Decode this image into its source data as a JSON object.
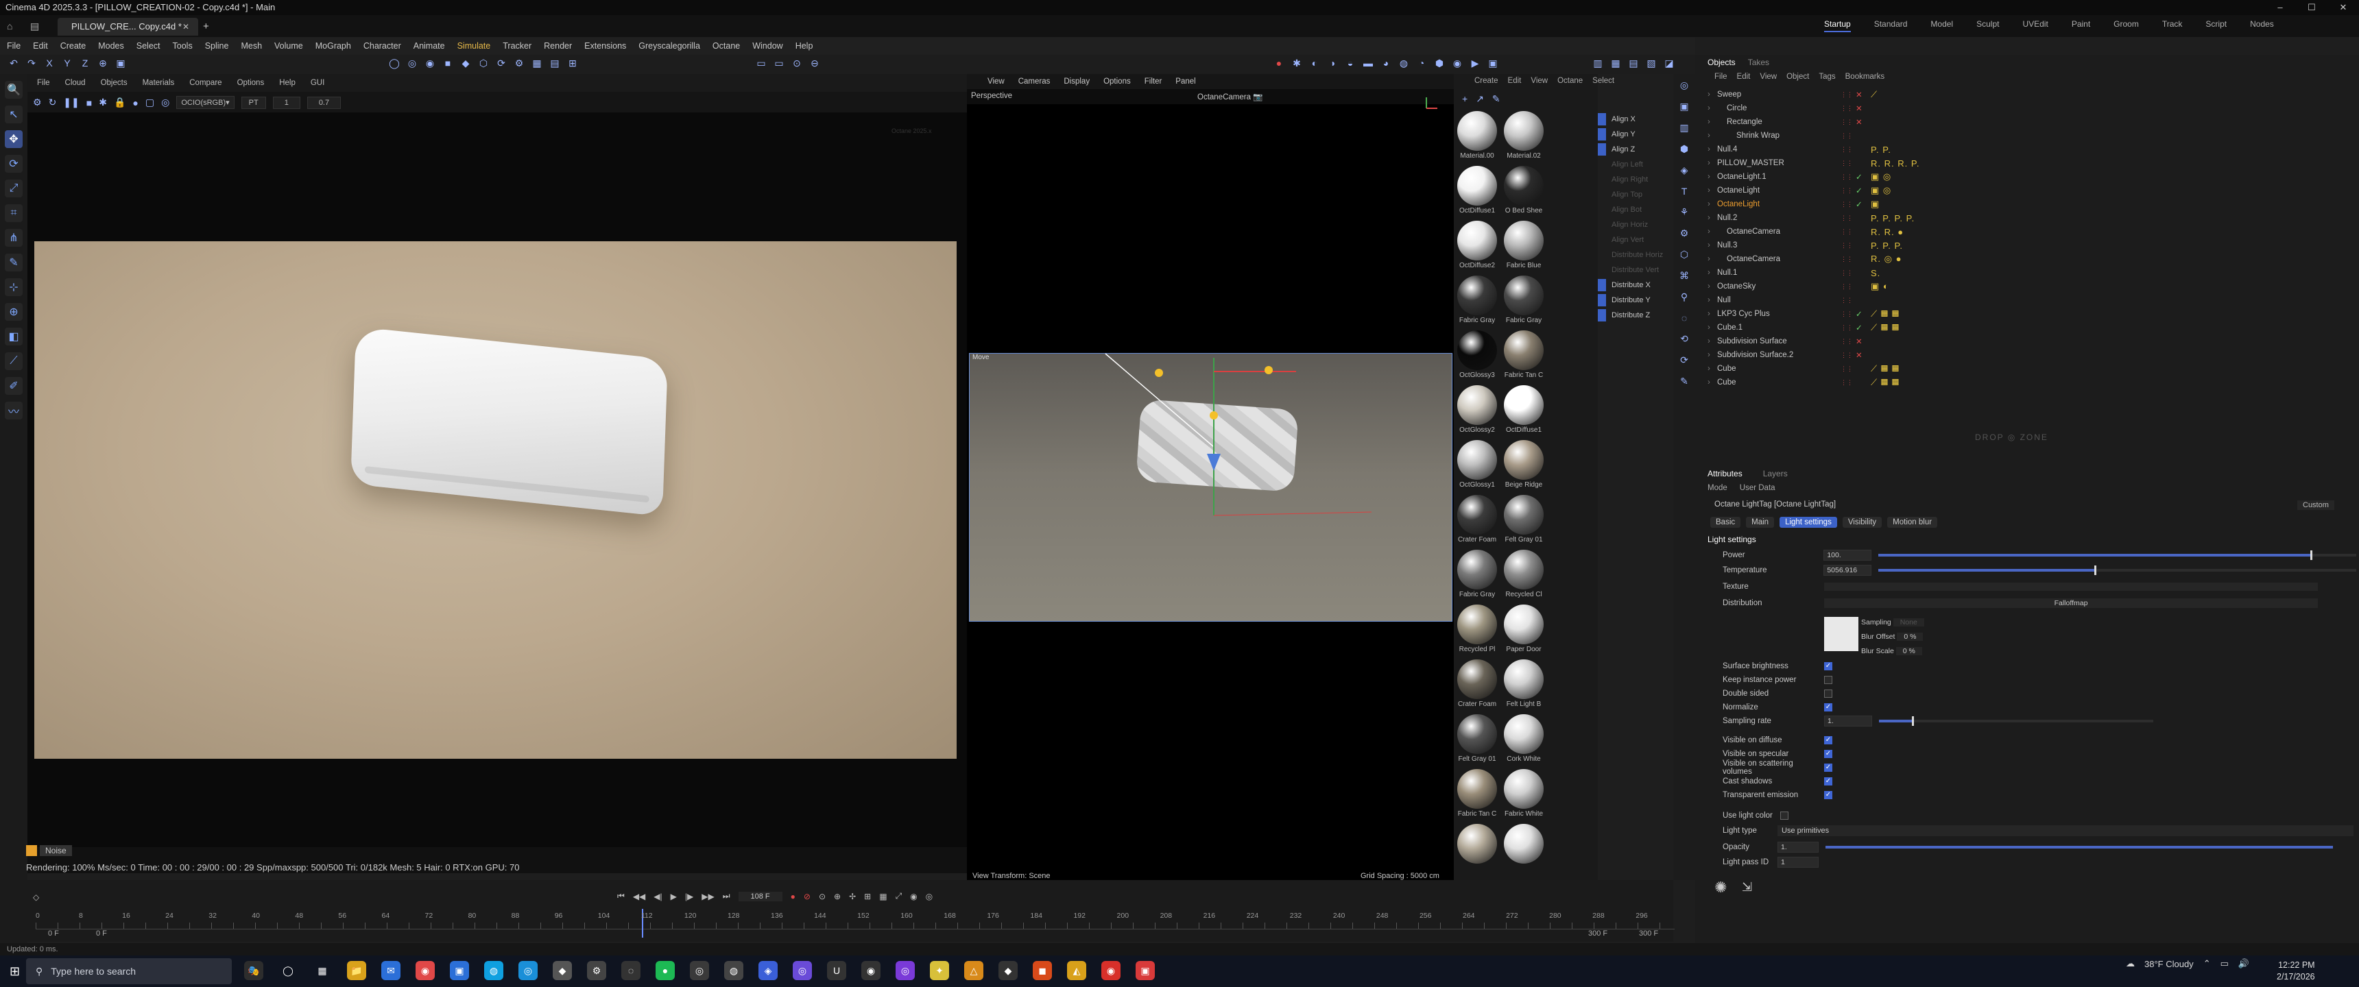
{
  "window": {
    "title": "Cinema 4D 2025.3.3 - [PILLOW_CREATION-02 - Copy.c4d *] - Main",
    "doc_tab": "PILLOW_CRE... Copy.c4d *",
    "controls": [
      "–",
      "☐",
      "✕"
    ]
  },
  "layouts": [
    "Startup",
    "Standard",
    "Model",
    "Sculpt",
    "UVEdit",
    "Paint",
    "Groom",
    "Track",
    "Script",
    "Nodes"
  ],
  "menu": [
    "File",
    "Edit",
    "Create",
    "Modes",
    "Select",
    "Tools",
    "Spline",
    "Mesh",
    "Volume",
    "MoGraph",
    "Character",
    "Animate",
    "Simulate",
    "Tracker",
    "Render",
    "Extensions",
    "Greyscalegorilla",
    "Octane",
    "Window",
    "Help"
  ],
  "viewport1": {
    "menu": [
      "File",
      "Cloud",
      "Objects",
      "Materials",
      "Compare",
      "Options",
      "Help",
      "GUI"
    ],
    "colorspace": "OCIO(sRGB)▾",
    "pt": "PT",
    "val1": "1",
    "val2": "0.7",
    "corner_text": "Octane 2025.x"
  },
  "render_status": {
    "line": "Rendering: 100% Ms/sec: 0   Time: 00 : 00 : 29/00 : 00 : 29  Spp/maxspp: 500/500   Tri: 0/182k   Mesh: 5  Hair: 0   RTX:on     GPU:    70",
    "tag1": "",
    "tag2": "Noise"
  },
  "viewport2": {
    "menu": [
      "View",
      "Cameras",
      "Display",
      "Options",
      "Filter",
      "Panel"
    ],
    "label": "Perspective",
    "camera": "OctaneCamera 📷",
    "footer_left": "View Transform: Scene",
    "footer_right": "Grid Spacing : 5000 cm",
    "inner_label": "Move"
  },
  "materials": {
    "menu": [
      "Create",
      "Edit",
      "View",
      "Octane",
      "Select"
    ],
    "items": [
      {
        "name": "Material.00",
        "c": "#dcdcdc"
      },
      {
        "name": "Material.02",
        "c": "#c8c8c8"
      },
      {
        "name": "OctDiffuse1",
        "c": "#f2f2f2"
      },
      {
        "name": "O Bed Shee",
        "c": "#2b2b2b"
      },
      {
        "name": "OctDiffuse2",
        "c": "#e6e6e6"
      },
      {
        "name": "Fabric Blue",
        "c": "#b9b9b9"
      },
      {
        "name": "Fabric Gray",
        "c": "#3a3a3a"
      },
      {
        "name": "Fabric Gray",
        "c": "#4a4a4a"
      },
      {
        "name": "OctGlossy3",
        "c": "#0a0a0a"
      },
      {
        "name": "Fabric Tan C",
        "c": "#8a8070"
      },
      {
        "name": "OctGlossy2",
        "c": "#cfcac0"
      },
      {
        "name": "OctDiffuse1",
        "c": "#ffffff"
      },
      {
        "name": "OctGlossy1",
        "c": "#bebebe"
      },
      {
        "name": "Beige Ridge",
        "c": "#a99c8a"
      },
      {
        "name": "Crater Foam",
        "c": "#3c3c3c"
      },
      {
        "name": "Felt Gray 01",
        "c": "#6e6e6e"
      },
      {
        "name": "Fabric Gray",
        "c": "#7a7a7a"
      },
      {
        "name": "Recycled Cl",
        "c": "#8e8e8e"
      },
      {
        "name": "Recycled Pl",
        "c": "#9e9682"
      },
      {
        "name": "Paper Door",
        "c": "#e3e3e3"
      },
      {
        "name": "Crater Foam",
        "c": "#6a6458"
      },
      {
        "name": "Felt Light B",
        "c": "#d0d0d0"
      },
      {
        "name": "Felt Gray 01",
        "c": "#555555"
      },
      {
        "name": "Cork White",
        "c": "#dadada"
      },
      {
        "name": "Fabric Tan C",
        "c": "#9a8e7a"
      },
      {
        "name": "Fabric White",
        "c": "#cfcfcf"
      },
      {
        "name": "",
        "c": "#b4ab9a"
      },
      {
        "name": "",
        "c": "#e0e0e0"
      }
    ]
  },
  "align": {
    "items": [
      {
        "label": "Align X",
        "on": true
      },
      {
        "label": "Align Y",
        "on": true
      },
      {
        "label": "Align Z",
        "on": true
      },
      {
        "label": "Align Left",
        "on": false
      },
      {
        "label": "Align Right",
        "on": false
      },
      {
        "label": "Align Top",
        "on": false
      },
      {
        "label": "Align Bot",
        "on": false
      },
      {
        "label": "Align Horiz",
        "on": false
      },
      {
        "label": "Align Vert",
        "on": false
      },
      {
        "label": "Distribute Horiz",
        "on": false
      },
      {
        "label": "Distribute Vert",
        "on": false
      },
      {
        "label": "Distribute X",
        "on": true
      },
      {
        "label": "Distribute Y",
        "on": true
      },
      {
        "label": "Distribute Z",
        "on": true
      }
    ]
  },
  "objects": {
    "tabs": [
      "Objects",
      "Takes"
    ],
    "menu": [
      "File",
      "Edit",
      "View",
      "Object",
      "Tags",
      "Bookmarks"
    ],
    "rows": [
      {
        "name": "Sweep",
        "ind": 0,
        "s": "x",
        "tags": "⟋"
      },
      {
        "name": "Circle",
        "ind": 1,
        "s": "x",
        "tags": ""
      },
      {
        "name": "Rectangle",
        "ind": 1,
        "s": "x",
        "tags": ""
      },
      {
        "name": "Shrink Wrap",
        "ind": 2,
        "s": "",
        "tags": ""
      },
      {
        "name": "Null.4",
        "ind": 0,
        "s": "",
        "tags": "P. P."
      },
      {
        "name": "PILLOW_MASTER",
        "ind": 0,
        "s": "",
        "tags": "R. R. R. P."
      },
      {
        "name": "OctaneLight.1",
        "ind": 0,
        "s": "ok",
        "tags": "▣ ◎"
      },
      {
        "name": "OctaneLight",
        "ind": 0,
        "s": "ok",
        "tags": "▣ ◎"
      },
      {
        "name": "OctaneLight",
        "ind": 0,
        "s": "ok",
        "tags": "▣",
        "hl": true
      },
      {
        "name": "Null.2",
        "ind": 0,
        "s": "",
        "tags": "P. P. P. P."
      },
      {
        "name": "OctaneCamera",
        "ind": 1,
        "s": "",
        "tags": "R. R. ●"
      },
      {
        "name": "Null.3",
        "ind": 0,
        "s": "",
        "tags": "P. P. P."
      },
      {
        "name": "OctaneCamera",
        "ind": 1,
        "s": "",
        "tags": "R. ◎ ●"
      },
      {
        "name": "Null.1",
        "ind": 0,
        "s": "",
        "tags": "S."
      },
      {
        "name": "OctaneSky",
        "ind": 0,
        "s": "",
        "tags": "▣ ◐"
      },
      {
        "name": "Null",
        "ind": 0,
        "s": "",
        "tags": ""
      },
      {
        "name": "LKP3 Cyc Plus",
        "ind": 0,
        "s": "ok",
        "tags": "⟋ ▦ ▦"
      },
      {
        "name": "Cube.1",
        "ind": 0,
        "s": "ok",
        "tags": "⟋ ▦ ▦"
      },
      {
        "name": "Subdivision Surface",
        "ind": 0,
        "s": "x",
        "tags": ""
      },
      {
        "name": "Subdivision Surface.2",
        "ind": 0,
        "s": "x",
        "tags": ""
      },
      {
        "name": "Cube",
        "ind": 0,
        "s": "",
        "tags": "⟋ ▦ ▦"
      },
      {
        "name": "Cube",
        "ind": 0,
        "s": "",
        "tags": "⟋ ▦ ▦"
      }
    ]
  },
  "dropzone": "DROP ◎ ZONE",
  "attributes": {
    "tabs": [
      "Attributes",
      "Layers"
    ],
    "mode": [
      "Mode",
      "User Data"
    ],
    "object": "Octane LightTag [Octane LightTag]",
    "preset": "Custom",
    "subtabs": [
      {
        "label": "Basic",
        "on": false
      },
      {
        "label": "Main",
        "on": false
      },
      {
        "label": "Light settings",
        "on": true
      },
      {
        "label": "Visibility",
        "on": false
      },
      {
        "label": "Motion blur",
        "on": false
      }
    ],
    "section": "Light settings",
    "power": {
      "label": "Power",
      "value": "100.",
      "fill": 0.9
    },
    "temperature": {
      "label": "Temperature",
      "value": "5056.916",
      "fill": 0.45
    },
    "texture": "Texture",
    "distribution": {
      "label": "Distribution",
      "value": "Falloffmap"
    },
    "sampling": {
      "a": "Sampling",
      "av": "None",
      "b": "Blur Offset",
      "bv": "0 %",
      "c": "Blur Scale",
      "cv": "0 %"
    },
    "checks": [
      {
        "label": "Surface brightness",
        "on": true
      },
      {
        "label": "Keep instance power",
        "on": false
      },
      {
        "label": "Double sided",
        "on": false
      },
      {
        "label": "Normalize",
        "on": true
      }
    ],
    "sampling_rate": {
      "label": "Sampling rate",
      "value": "1.",
      "fill": 0.12
    },
    "vis": [
      {
        "label": "Visible on diffuse",
        "on": true
      },
      {
        "label": "Visible on specular",
        "on": true
      },
      {
        "label": "Visible on scattering volumes",
        "on": true
      },
      {
        "label": "Cast shadows",
        "on": true
      },
      {
        "label": "Transparent emission",
        "on": true
      }
    ],
    "light_color": {
      "label": "Use light color",
      "on": false
    },
    "light_type": {
      "label": "Light type",
      "value": "Use primitives"
    },
    "opacity": {
      "label": "Opacity",
      "value": "1.",
      "fill": 1.0
    },
    "pass": {
      "label": "Light pass ID",
      "value": "1"
    }
  },
  "timeline": {
    "frame": "108 F",
    "ticks": [
      "0",
      "8",
      "16",
      "24",
      "32",
      "40",
      "48",
      "56",
      "64",
      "72",
      "80",
      "88",
      "96",
      "104",
      "112",
      "120",
      "128",
      "136",
      "144",
      "152",
      "160",
      "168",
      "176",
      "184",
      "192",
      "200",
      "208",
      "216",
      "224",
      "232",
      "240",
      "248",
      "256",
      "264",
      "272",
      "280",
      "288",
      "296"
    ],
    "start": "0 F",
    "start2": "0 F",
    "end": "300 F",
    "end2": "300 F",
    "playhead_frac": 0.37
  },
  "status": "Updated: 0 ms.",
  "taskbar": {
    "search": "Type here to search",
    "weather": "38°F  Cloudy",
    "time": "12:22 PM",
    "date": "2/17/2026"
  }
}
